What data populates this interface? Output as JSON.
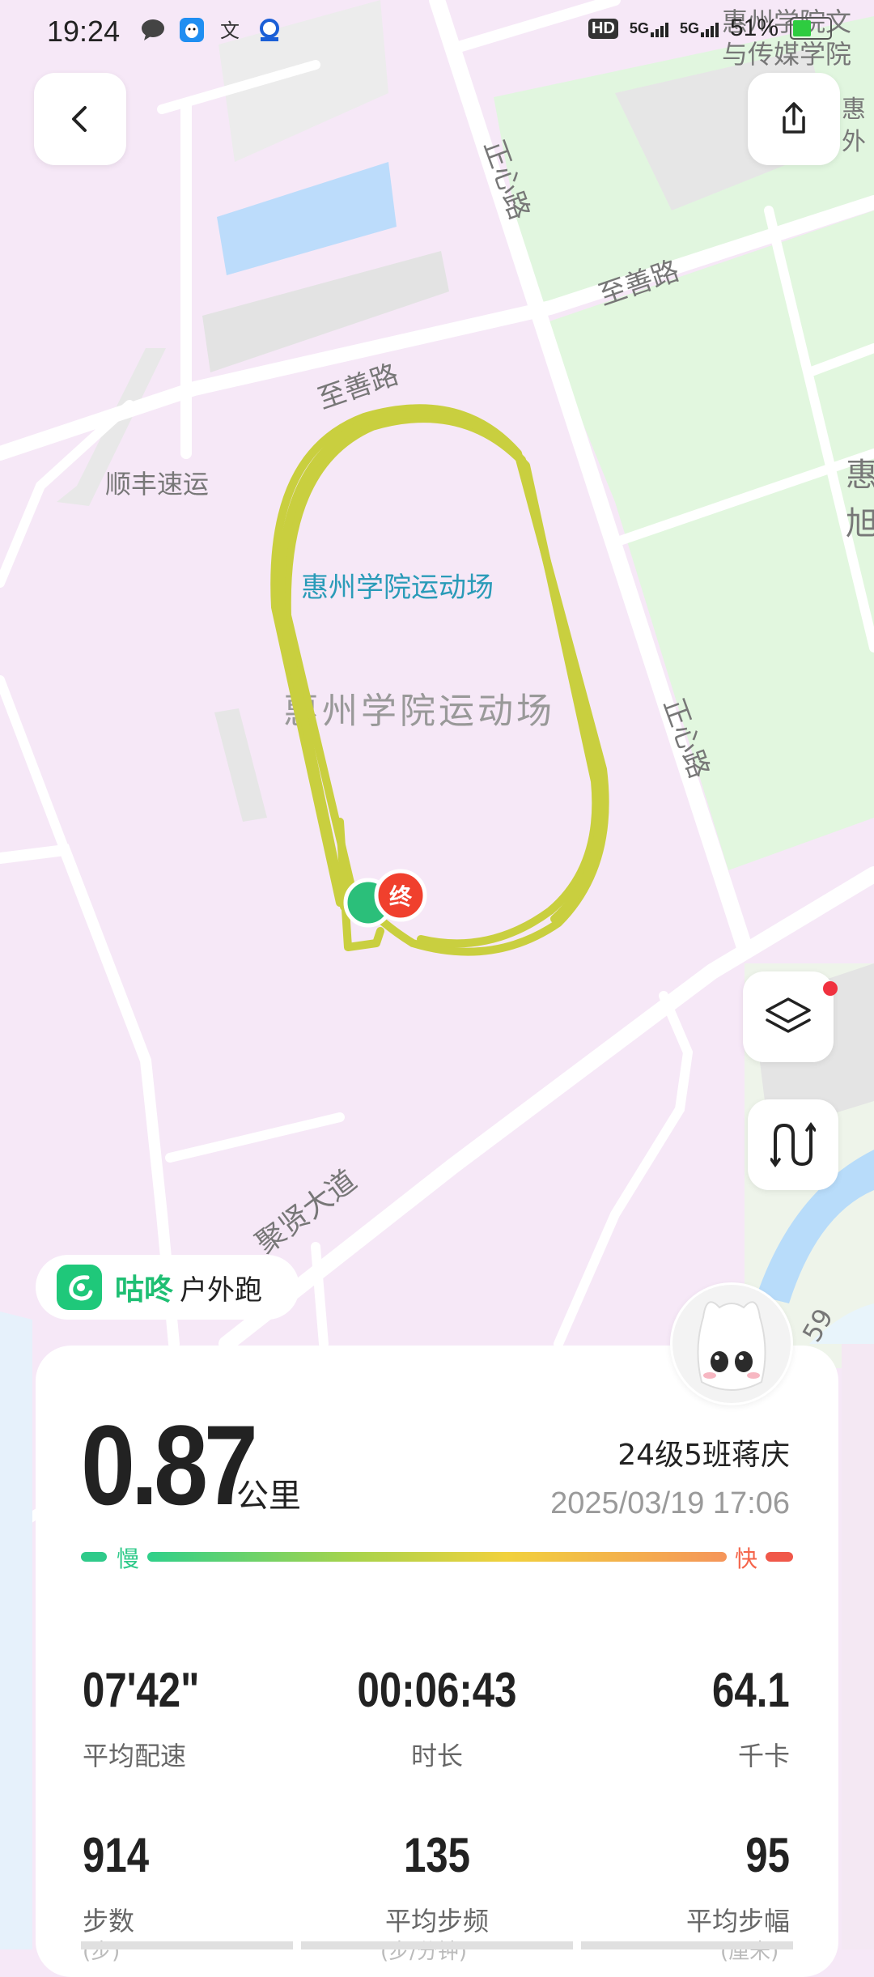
{
  "status_bar": {
    "time": "19:24",
    "signal_labels": [
      "HD",
      "5G",
      "5G"
    ],
    "battery": "51%"
  },
  "map": {
    "labels": {
      "zhengxin_road_top": "正心路",
      "zhishan_road_right": "至善路",
      "zhishan_road_left": "至善路",
      "shunfeng": "顺丰速运",
      "stadium_blue": "惠州学院运动场",
      "stadium_gray": "惠州学院运动场",
      "zhengxin_road_mid": "正心路",
      "juxian_avenue": "聚贤大道",
      "top_right_poi_1": "惠州学院文",
      "top_right_poi_2": "与传媒学院",
      "right_poi_a": "惠",
      "right_poi_b": "外",
      "right_poi_c": "惠",
      "right_poi_d": "旭",
      "road_num": "59",
      "end_marker": "终"
    },
    "colors": {
      "track": "#c9cf3f",
      "end_marker": "#f0402d",
      "start_marker": "#2bbf7a"
    }
  },
  "app": {
    "name": "咕咚",
    "activity": "户外跑"
  },
  "summary": {
    "distance": "0.87",
    "distance_unit": "公里",
    "user": "24级5班蒋庆",
    "datetime": "2025/03/19 17:06",
    "pace_slow_label": "慢",
    "pace_fast_label": "快"
  },
  "stats": [
    {
      "value": "07'42\"",
      "label": "平均配速"
    },
    {
      "value": "00:06:43",
      "label": "时长"
    },
    {
      "value": "64.1",
      "label": "千卡"
    },
    {
      "value": "914",
      "label": "步数"
    },
    {
      "value": "135",
      "label": "平均步频"
    },
    {
      "value": "95",
      "label": "平均步幅"
    }
  ],
  "stat_units_peek": [
    "(步)",
    "(步/分钟)",
    "(厘米)"
  ]
}
